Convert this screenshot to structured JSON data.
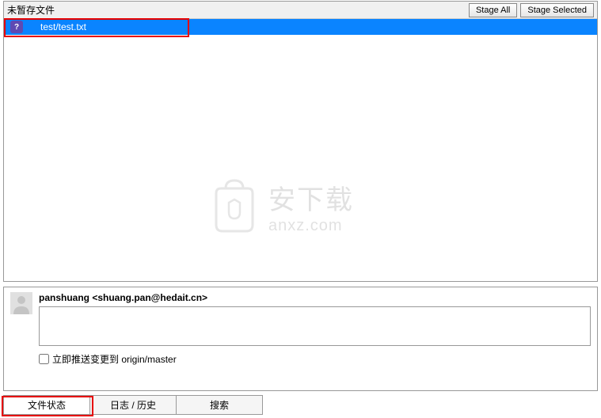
{
  "unstaged": {
    "title": "未暂存文件",
    "stage_all_label": "Stage All",
    "stage_selected_label": "Stage Selected",
    "files": [
      {
        "icon": "?",
        "path": "test/test.txt"
      }
    ]
  },
  "commit": {
    "author": "panshuang <shuang.pan@hedait.cn>",
    "message": "",
    "push_label": "立即推送变更到 origin/master",
    "push_checked": false
  },
  "tabs": {
    "items": [
      {
        "label": "文件状态",
        "active": true
      },
      {
        "label": "日志 / 历史",
        "active": false
      },
      {
        "label": "搜索",
        "active": false
      }
    ]
  },
  "watermark": {
    "cn": "安下载",
    "en": "anxz.com"
  }
}
